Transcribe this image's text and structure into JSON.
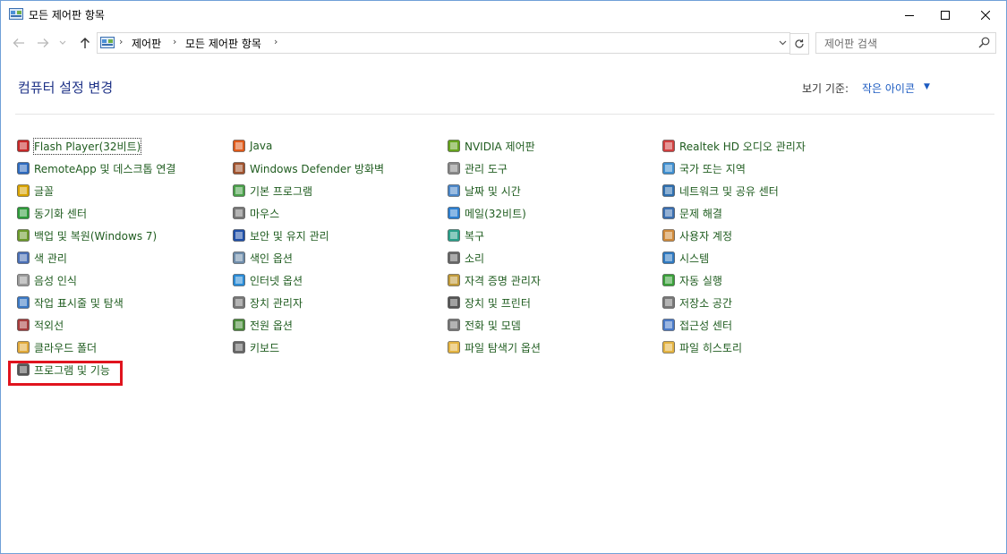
{
  "window": {
    "title": "모든 제어판 항목",
    "accent": "#6f9fd8"
  },
  "address": {
    "crumbs": [
      "제어판",
      "모든 제어판 항목"
    ]
  },
  "search": {
    "placeholder": "제어판 검색"
  },
  "heading": "컴퓨터 설정 변경",
  "view_by": {
    "label": "보기 기준:",
    "value": "작은 아이콘"
  },
  "colors": {
    "link": "#1f5c1f",
    "heading": "#1e3287",
    "highlight": "#e0141e"
  },
  "items": [
    {
      "label": "Flash Player(32비트)",
      "icon": "flash-icon"
    },
    {
      "label": "RemoteApp 및 데스크톱 연결",
      "icon": "remoteapp-icon"
    },
    {
      "label": "글꼴",
      "icon": "fonts-icon"
    },
    {
      "label": "동기화 센터",
      "icon": "sync-icon"
    },
    {
      "label": "백업 및 복원(Windows 7)",
      "icon": "backup-icon"
    },
    {
      "label": "색 관리",
      "icon": "color-management-icon"
    },
    {
      "label": "음성 인식",
      "icon": "speech-icon"
    },
    {
      "label": "작업 표시줄 및 탐색",
      "icon": "taskbar-icon"
    },
    {
      "label": "적외선",
      "icon": "infrared-icon"
    },
    {
      "label": "클라우드 폴더",
      "icon": "cloud-folder-icon"
    },
    {
      "label": "프로그램 및 기능",
      "icon": "programs-features-icon"
    },
    {
      "label": "Java",
      "icon": "java-icon"
    },
    {
      "label": "Windows Defender 방화벽",
      "icon": "firewall-icon"
    },
    {
      "label": "기본 프로그램",
      "icon": "default-programs-icon"
    },
    {
      "label": "마우스",
      "icon": "mouse-icon"
    },
    {
      "label": "보안 및 유지 관리",
      "icon": "flag-icon"
    },
    {
      "label": "색인 옵션",
      "icon": "indexing-icon"
    },
    {
      "label": "인터넷 옵션",
      "icon": "internet-icon"
    },
    {
      "label": "장치 관리자",
      "icon": "device-manager-icon"
    },
    {
      "label": "전원 옵션",
      "icon": "power-icon"
    },
    {
      "label": "키보드",
      "icon": "keyboard-icon"
    },
    {
      "label": "NVIDIA 제어판",
      "icon": "nvidia-icon"
    },
    {
      "label": "관리 도구",
      "icon": "admin-tools-icon"
    },
    {
      "label": "날짜 및 시간",
      "icon": "datetime-icon"
    },
    {
      "label": "메일(32비트)",
      "icon": "mail-icon"
    },
    {
      "label": "복구",
      "icon": "recovery-icon"
    },
    {
      "label": "소리",
      "icon": "sound-icon"
    },
    {
      "label": "자격 증명 관리자",
      "icon": "credential-icon"
    },
    {
      "label": "장치 및 프린터",
      "icon": "printer-icon"
    },
    {
      "label": "전화 및 모뎀",
      "icon": "phone-icon"
    },
    {
      "label": "파일 탐색기 옵션",
      "icon": "folder-options-icon"
    },
    {
      "label": "Realtek HD 오디오 관리자",
      "icon": "realtek-icon"
    },
    {
      "label": "국가 또는 지역",
      "icon": "region-icon"
    },
    {
      "label": "네트워크 및 공유 센터",
      "icon": "network-icon"
    },
    {
      "label": "문제 해결",
      "icon": "troubleshoot-icon"
    },
    {
      "label": "사용자 계정",
      "icon": "user-accounts-icon"
    },
    {
      "label": "시스템",
      "icon": "system-icon"
    },
    {
      "label": "자동 실행",
      "icon": "autoplay-icon"
    },
    {
      "label": "저장소 공간",
      "icon": "storage-icon"
    },
    {
      "label": "접근성 센터",
      "icon": "accessibility-icon"
    },
    {
      "label": "파일 히스토리",
      "icon": "file-history-icon"
    }
  ]
}
